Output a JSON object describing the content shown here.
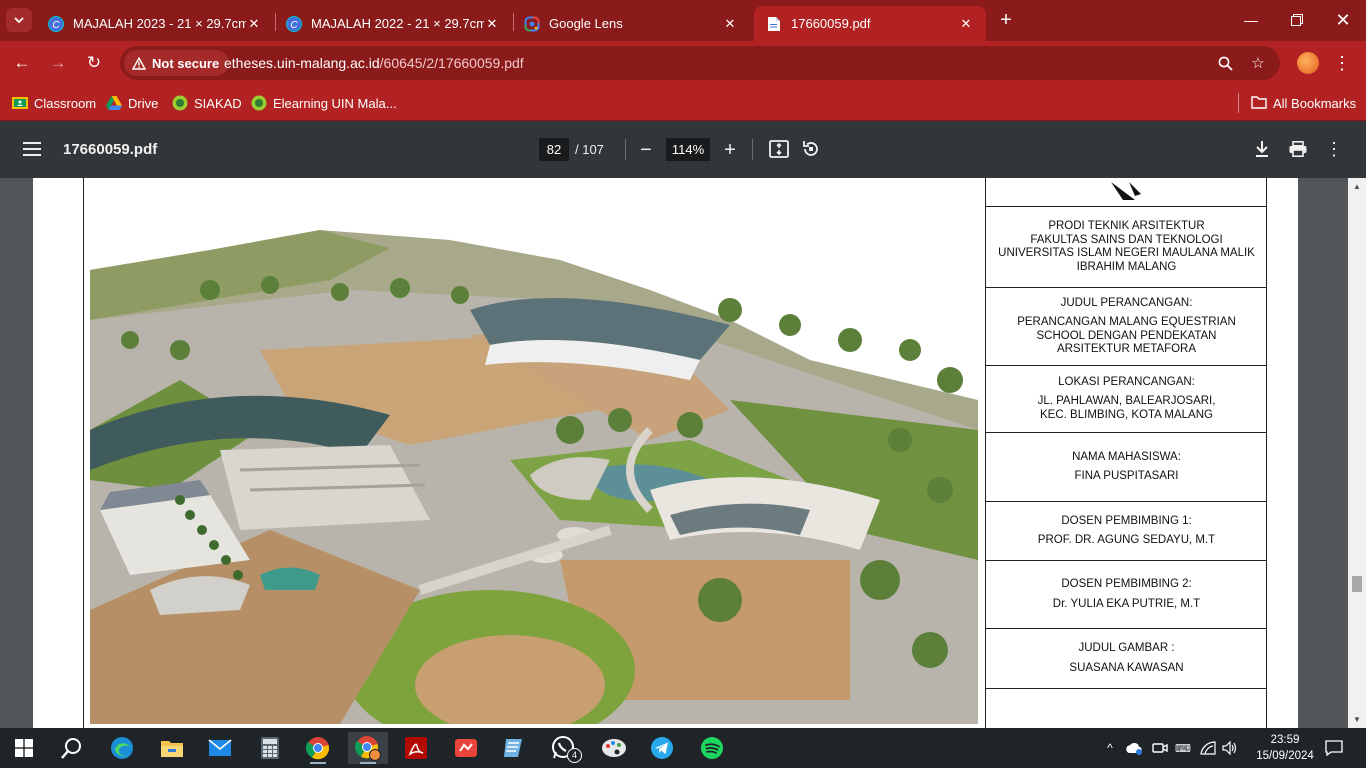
{
  "browser": {
    "tabs": [
      {
        "title": "MAJALAH 2023 - 21 × 29.7cm",
        "icon": "canva-icon",
        "active": false
      },
      {
        "title": "MAJALAH 2022 - 21 × 29.7cm",
        "icon": "canva-icon",
        "active": false
      },
      {
        "title": "Google Lens",
        "icon": "google-lens-icon",
        "active": false
      },
      {
        "title": "17660059.pdf",
        "icon": "pdf-file-icon",
        "active": true
      }
    ],
    "security_label": "Not secure",
    "url_host": "etheses.uin-malang.ac.id",
    "url_path": "/60645/2/17660059.pdf",
    "bookmarks": [
      {
        "label": "Classroom",
        "icon": "classroom-icon"
      },
      {
        "label": "Drive",
        "icon": "google-drive-icon"
      },
      {
        "label": "SIAKAD",
        "icon": "siakad-icon"
      },
      {
        "label": "Elearning UIN Mala...",
        "icon": "elearning-icon"
      }
    ],
    "all_bookmarks_label": "All Bookmarks",
    "theme_color": "#b22222"
  },
  "pdf": {
    "filename": "17660059.pdf",
    "current_page": "82",
    "page_total": "/ 107",
    "zoom": "114%"
  },
  "titleblock": {
    "institution": [
      "PRODI TEKNIK ARSITEKTUR",
      "FAKULTAS SAINS DAN TEKNOLOGI",
      "UNIVERSITAS ISLAM NEGERI MAULANA MALIK",
      "IBRAHIM MALANG"
    ],
    "design_title_heading": "JUDUL PERANCANGAN:",
    "design_title": [
      "PERANCANGAN MALANG EQUESTRIAN",
      "SCHOOL DENGAN PENDEKATAN",
      "ARSITEKTUR METAFORA"
    ],
    "location_heading": "LOKASI PERANCANGAN:",
    "location": [
      "JL. PAHLAWAN, BALEARJOSARI,",
      "KEC. BLIMBING, KOTA MALANG"
    ],
    "student_heading": "NAMA MAHASISWA:",
    "student": "FINA PUSPITASARI",
    "advisor1_heading": "DOSEN PEMBIMBING 1:",
    "advisor1": "PROF. DR. AGUNG SEDAYU, M.T",
    "advisor2_heading": "DOSEN PEMBIMBING 2:",
    "advisor2": "Dr. YULIA EKA PUTRIE, M.T",
    "drawing_title_heading": "JUDUL GAMBAR :",
    "drawing_title": "SUASANA KAWASAN"
  },
  "taskbar": {
    "apps": [
      "start-icon",
      "search-icon",
      "edge-icon",
      "file-explorer-icon",
      "mail-icon",
      "calculator-icon",
      "chrome-icon",
      "chrome-profile-icon",
      "acrobat-icon",
      "wps-presentation-icon",
      "word-icon",
      "whatsapp-icon",
      "paint-icon",
      "telegram-icon",
      "spotify-icon"
    ],
    "whatsapp_badge": "4",
    "time": "23:59",
    "date": "15/09/2024"
  }
}
